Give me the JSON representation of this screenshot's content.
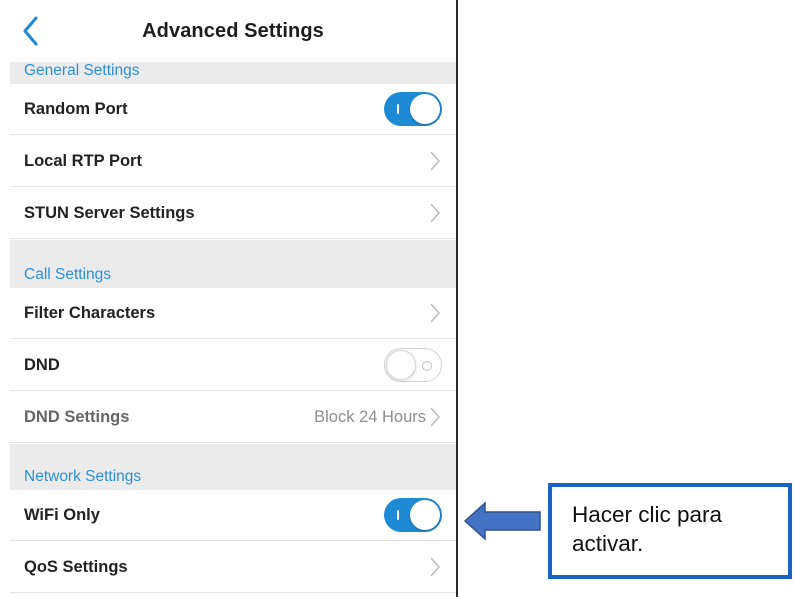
{
  "navbar": {
    "title": "Advanced Settings",
    "back_icon": "chevron-left-icon"
  },
  "colors": {
    "accent": "#1e8ad6",
    "section_text": "#2d8fd8",
    "section_bg": "#ebebeb",
    "callout_border": "#1764c4",
    "arrow_fill": "#4472c4"
  },
  "sections": {
    "general": {
      "title": "General Settings",
      "random_port": {
        "label": "Random Port",
        "toggle": "on"
      },
      "local_rtp_port": {
        "label": "Local RTP Port"
      },
      "stun_server": {
        "label": "STUN Server Settings"
      }
    },
    "call": {
      "title": "Call Settings",
      "filter_characters": {
        "label": "Filter Characters"
      },
      "dnd": {
        "label": "DND",
        "toggle": "off"
      },
      "dnd_settings": {
        "label": "DND Settings",
        "value": "Block 24 Hours"
      }
    },
    "network": {
      "title": "Network Settings",
      "wifi_only": {
        "label": "WiFi Only",
        "toggle": "on"
      },
      "qos_settings": {
        "label": "QoS Settings"
      }
    }
  },
  "callout": {
    "text": "Hacer clic para activar."
  }
}
